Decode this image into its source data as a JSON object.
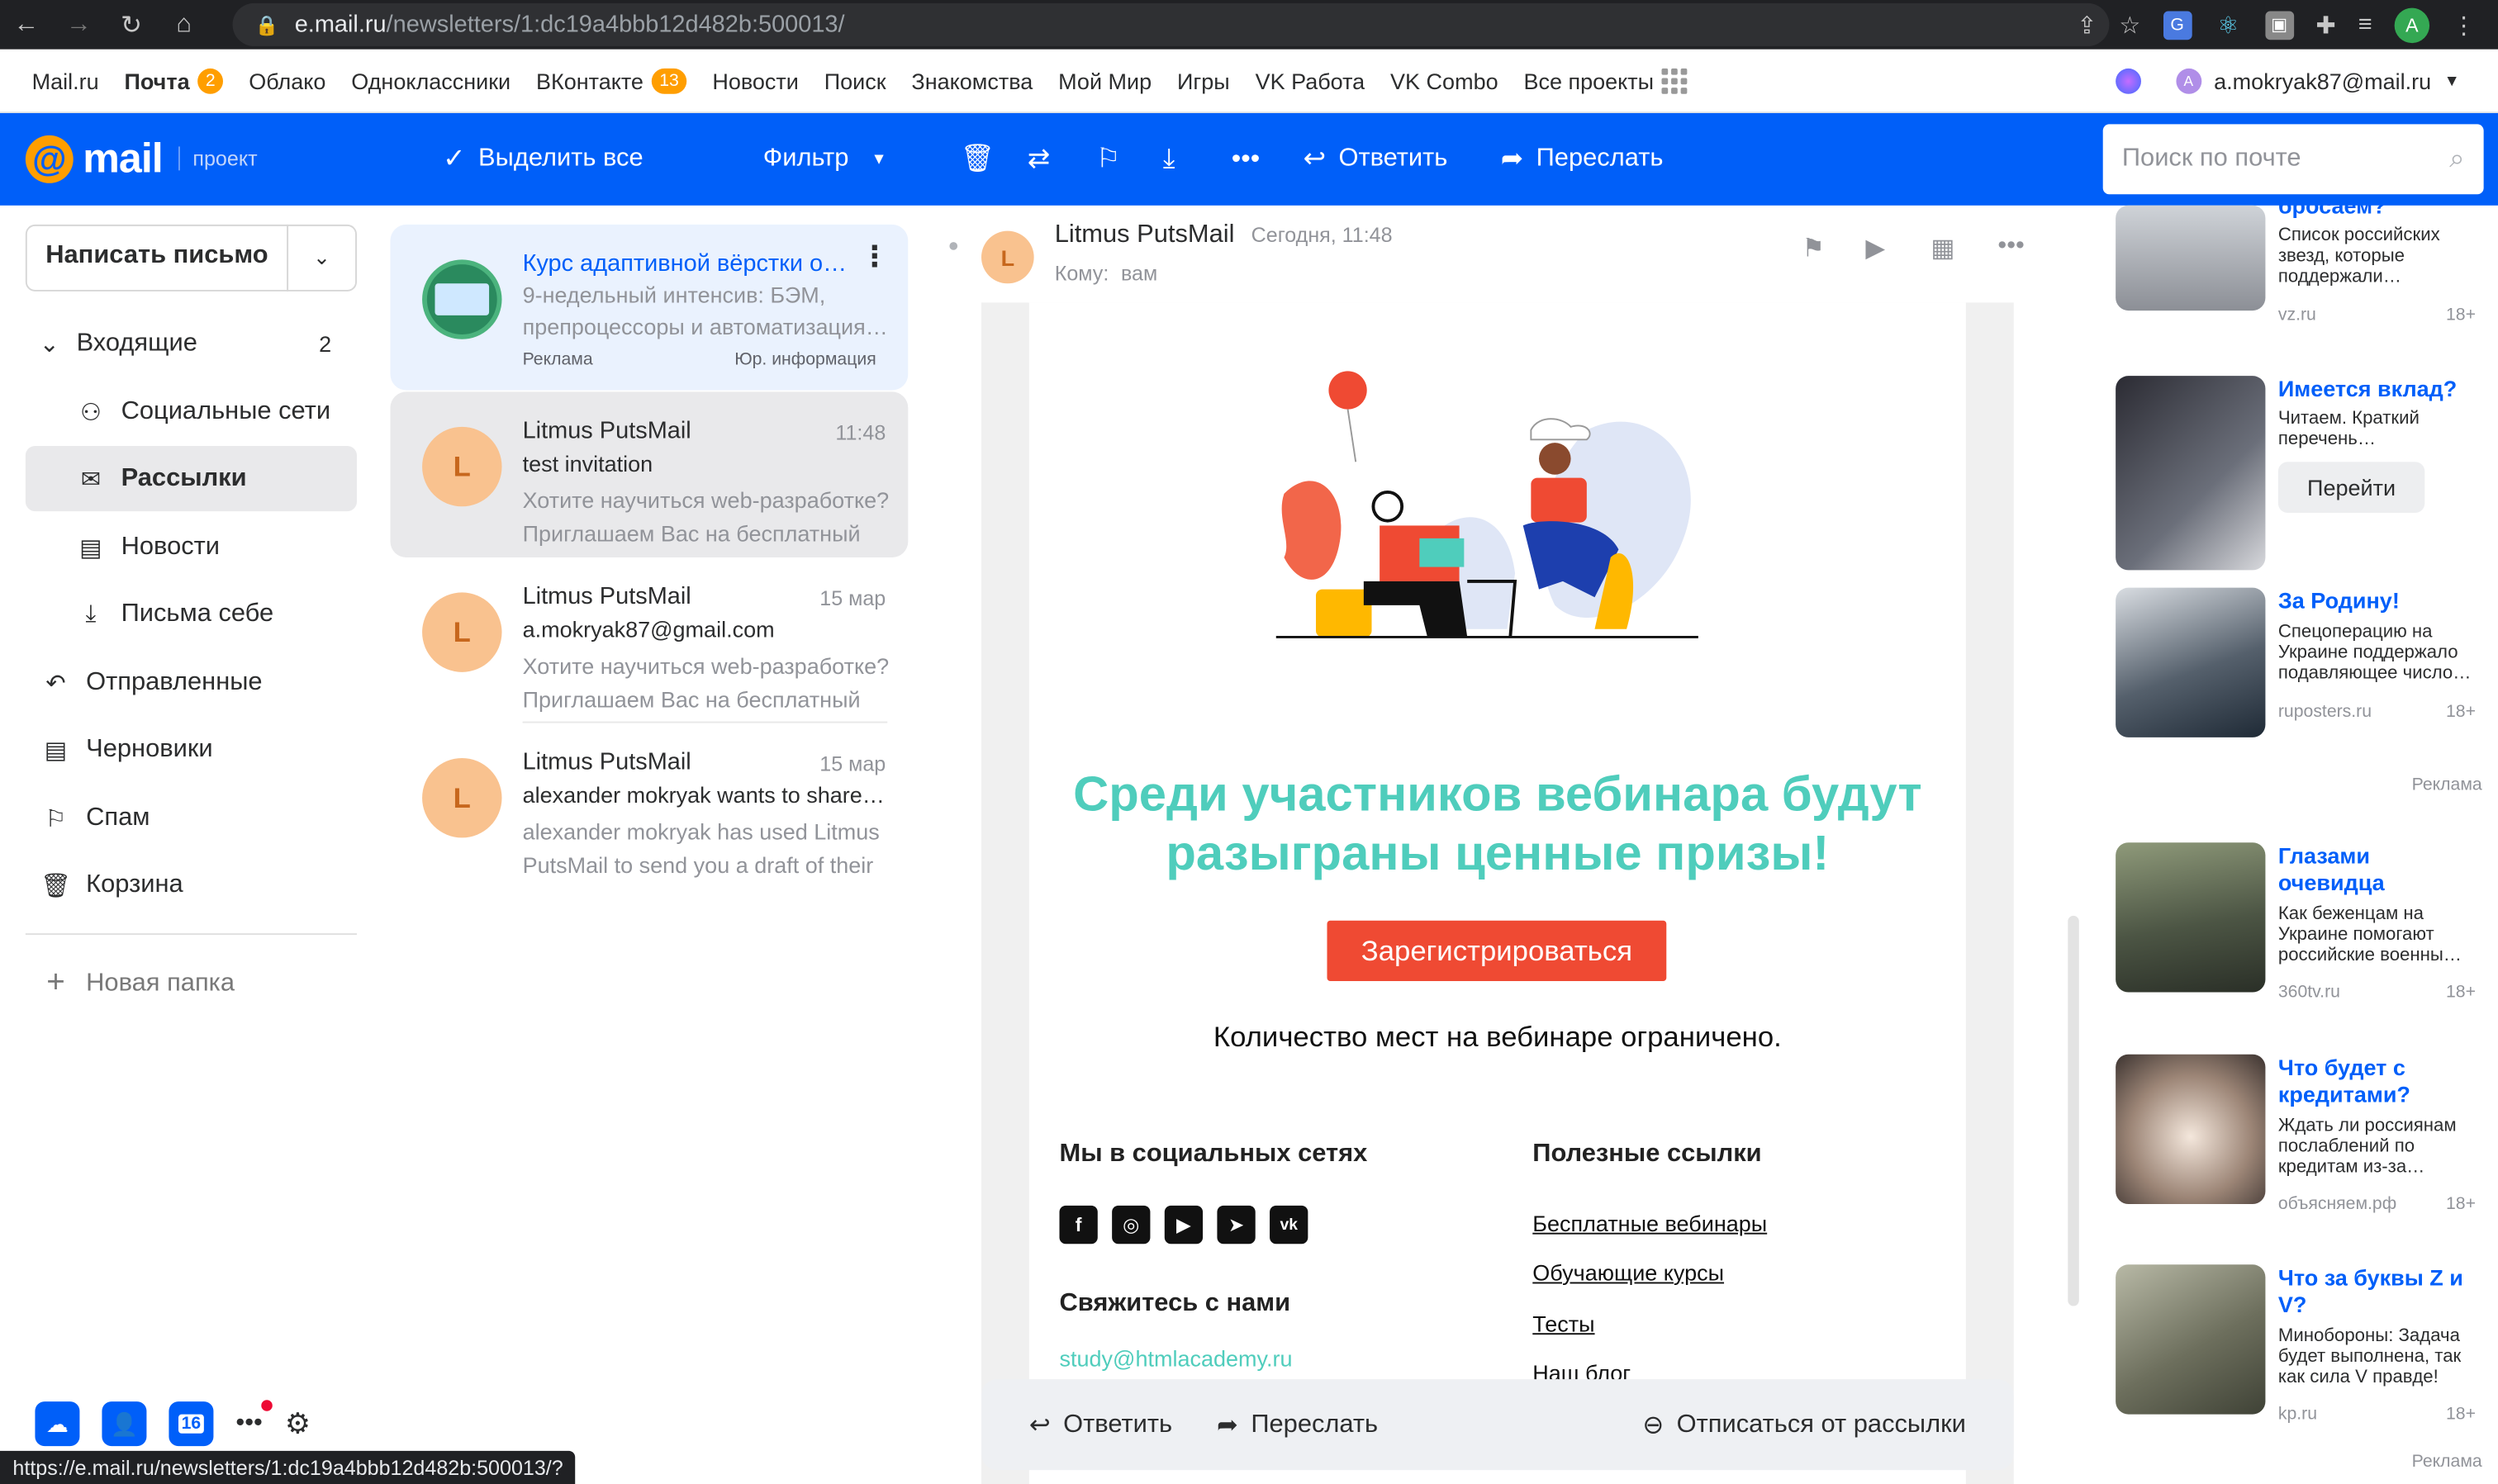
{
  "browser": {
    "url_host": "e.mail.ru",
    "url_path": "/newsletters/1:dc19a4bbb12d482b:500013/",
    "profile_initial": "A",
    "status_url": "https://e.mail.ru/newsletters/1:dc19a4bbb12d482b:500013/?"
  },
  "portal": {
    "links": [
      {
        "label": "Mail.ru"
      },
      {
        "label": "Почта",
        "badge": "2"
      },
      {
        "label": "Облако"
      },
      {
        "label": "Одноклассники"
      },
      {
        "label": "ВКонтакте",
        "badge": "13"
      },
      {
        "label": "Новости"
      },
      {
        "label": "Поиск"
      },
      {
        "label": "Знакомства"
      },
      {
        "label": "Мой Мир"
      },
      {
        "label": "Игры"
      },
      {
        "label": "VK Работа"
      },
      {
        "label": "VK Combo"
      },
      {
        "label": "Все проекты"
      }
    ],
    "user_initial": "A",
    "user_email": "a.mokryak87@mail.ru"
  },
  "toolbar": {
    "logo_word": "mail",
    "logo_project": "проект",
    "select_all": "Выделить все",
    "filter": "Фильтр",
    "reply": "Ответить",
    "forward": "Переслать",
    "search_placeholder": "Поиск по почте"
  },
  "sidebar": {
    "compose": "Написать письмо",
    "folders": [
      {
        "label": "Входящие",
        "count": "2"
      },
      {
        "label": "Социальные сети"
      },
      {
        "label": "Рассылки"
      },
      {
        "label": "Новости"
      },
      {
        "label": "Письма себе"
      },
      {
        "label": "Отправленные"
      },
      {
        "label": "Черновики"
      },
      {
        "label": "Спам"
      },
      {
        "label": "Корзина"
      }
    ],
    "new_folder": "Новая папка",
    "calendar_day": "16"
  },
  "messages": [
    {
      "from": "Курс адаптивной вёрстки о…",
      "subject": "9-недельный интенсив: БЭМ,",
      "snippet": "препроцессоры и автоматизация…",
      "ad_label": "Реклама",
      "legal": "Юр. информация"
    },
    {
      "avatar": "L",
      "from": "Litmus PutsMail",
      "date": "11:48",
      "subject": "test invitation",
      "snippet": "Хотите научиться web-разработке? Приглашаем Вас на бесплатный"
    },
    {
      "avatar": "L",
      "from": "Litmus PutsMail",
      "date": "15 мар",
      "subject": "a.mokryak87@gmail.com",
      "snippet": "Хотите научиться web-разработке? Приглашаем Вас на бесплатный"
    },
    {
      "avatar": "L",
      "from": "Litmus PutsMail",
      "date": "15 мар",
      "subject": "alexander mokryak wants to share d…",
      "snippet": "alexander mokryak has used Litmus PutsMail to send you a draft of their"
    }
  ],
  "reader": {
    "avatar": "L",
    "from": "Litmus PutsMail",
    "date": "Сегодня, 11:48",
    "to_label": "Кому:",
    "to": "вам",
    "headline": "Среди участников вебинара будут разыграны ценные призы!",
    "register": "Зарегистрироваться",
    "seats": "Количество мест на вебинаре ограничено.",
    "social_heading": "Мы в социальных сетях",
    "links_heading": "Полезные ссылки",
    "contact_heading": "Свяжитесь с нами",
    "email": "study@htmlacademy.ru",
    "links": [
      "Бесплатные вебинары",
      "Обучающие курсы",
      "Тесты",
      "Наш блог"
    ],
    "reply": "Ответить",
    "forward": "Переслать",
    "unsubscribe": "Отписаться от рассылки"
  },
  "ads": [
    {
      "title": "бросаем?",
      "desc": "Список российских звезд, которые поддержали…",
      "source": "vz.ru",
      "age": "18+"
    },
    {
      "title": "Имеется вклад?",
      "desc": "Читаем. Краткий перечень…",
      "button": "Перейти"
    },
    {
      "title": "За Родину!",
      "desc": "Спецоперацию на Украине поддержало подавляющее число…",
      "source": "ruposters.ru",
      "age": "18+"
    },
    {
      "title": "Глазами очевидца",
      "desc": "Как беженцам на Украине помогают российские военны…",
      "source": "360tv.ru",
      "age": "18+"
    },
    {
      "title": "Что будет с кредитами?",
      "desc": "Ждать ли россиянам послаблений по кредитам из-за…",
      "source": "объясняем.рф",
      "age": "18+"
    },
    {
      "title": "Что за буквы Z и V?",
      "desc": "Минобороны: Задача будет выполнена, так как сила V правде!",
      "source": "kp.ru",
      "age": "18+"
    }
  ],
  "ad_label": "Реклама"
}
